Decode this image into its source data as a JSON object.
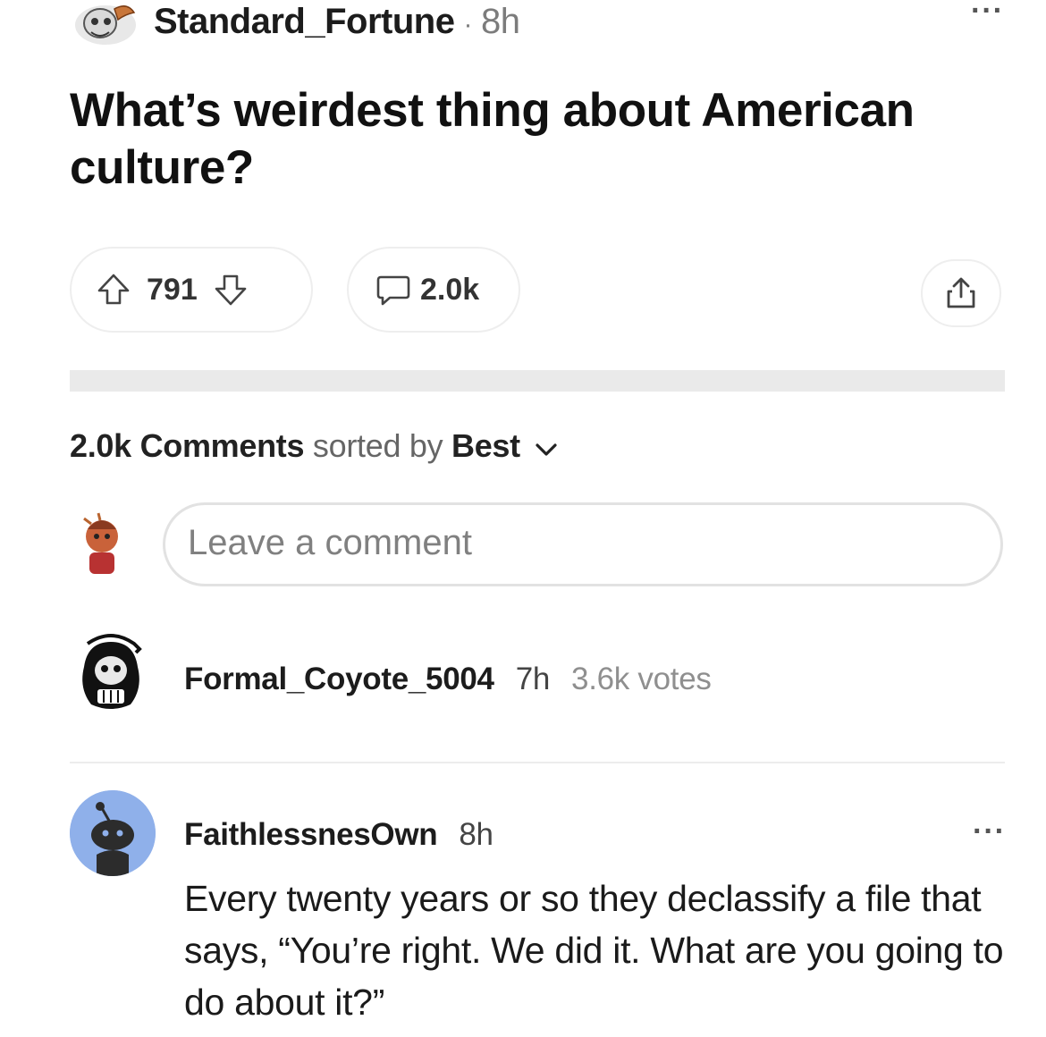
{
  "post": {
    "author": "Standard_Fortune",
    "separator": "·",
    "time": "8h",
    "more_label": "···",
    "title": "What’s weirdest thing about American culture?",
    "upvotes": "791",
    "comments_count": "2.0k"
  },
  "comments_header": {
    "count_label": "2.0k Comments",
    "sorted_by_label": "sorted by",
    "sort_value": "Best"
  },
  "comment_input": {
    "placeholder": "Leave a comment"
  },
  "comments": [
    {
      "author": "Formal_Coyote_5004",
      "time": "7h",
      "votes": "3.6k votes"
    },
    {
      "author": "FaithlessnesOwn",
      "time": "8h",
      "more_label": "···",
      "body": "Every twenty years or so they declassify a file that says, “You’re right. We did it. What are you going to do about it?”"
    }
  ],
  "icons": [
    "user-avatar-icon",
    "more-options-icon",
    "upvote-icon",
    "downvote-icon",
    "comment-icon",
    "share-icon",
    "chevron-down-icon"
  ],
  "colors": {
    "avatar_blue": "#8fb0ea",
    "divider": "#eaeaea",
    "text": "#1a1a1b"
  }
}
